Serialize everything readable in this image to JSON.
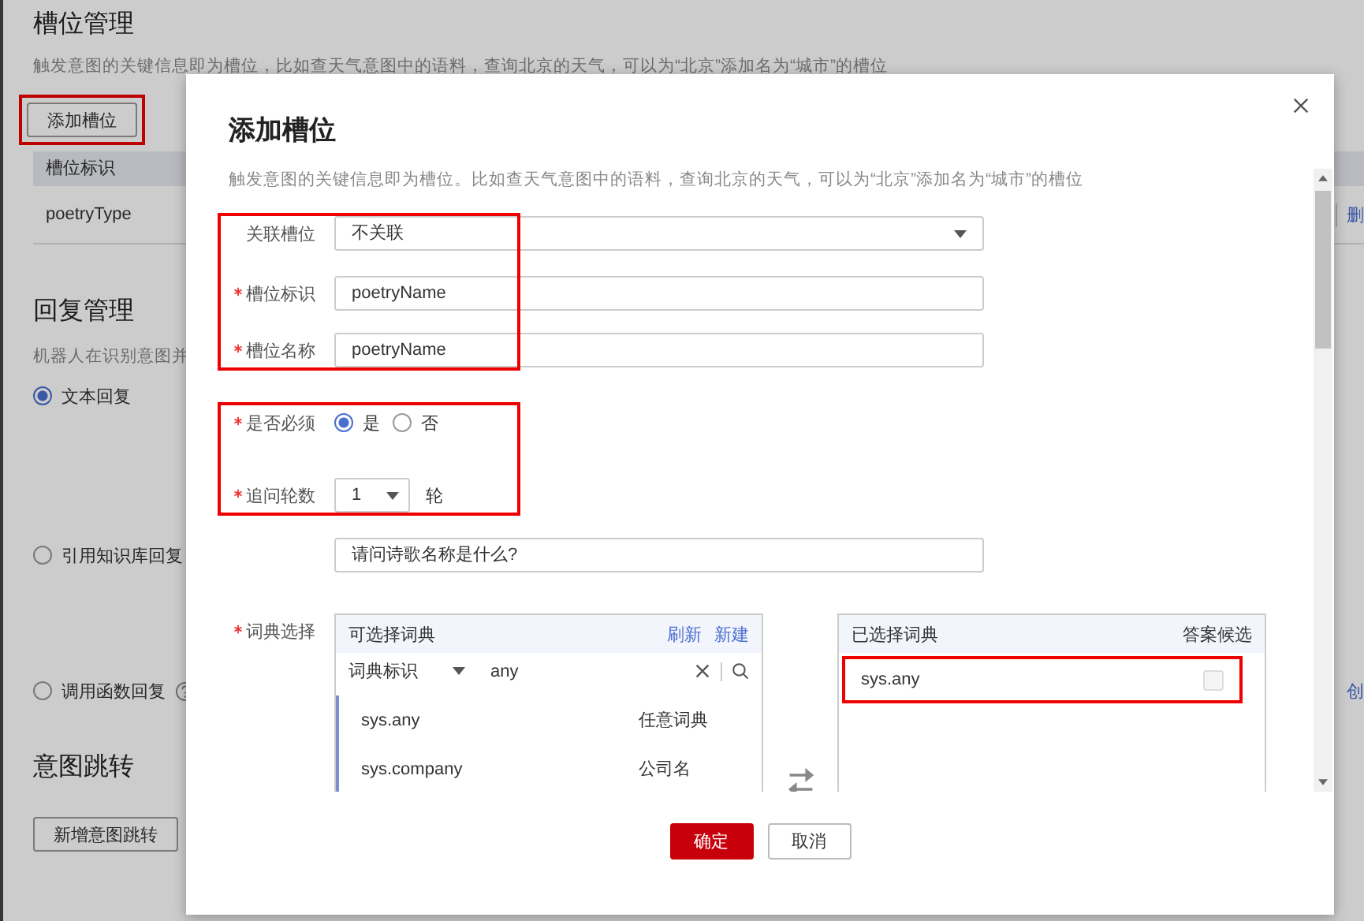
{
  "page": {
    "title": "槽位管理",
    "description": "触发意图的关键信息即为槽位，比如查天气意图中的语料，查询北京的天气，可以为“北京”添加名为“城市”的槽位",
    "add_button": {
      "label": "添加槽位",
      "highlighted": true
    },
    "table": {
      "columns": [
        "槽位标识"
      ],
      "rows": [
        {
          "cells": [
            "poetryType"
          ],
          "action": "删"
        }
      ]
    },
    "reply": {
      "title": "回复管理",
      "description": "机器人在识别意图并",
      "options": [
        {
          "label": "文本回复",
          "selected": true,
          "help": false
        },
        {
          "label": "引用知识库回复",
          "selected": false,
          "help": false
        },
        {
          "label": "调用函数回复",
          "selected": false,
          "help": true,
          "action": "创"
        }
      ]
    },
    "jump": {
      "title": "意图跳转",
      "button": "新增意图跳转"
    }
  },
  "dialog": {
    "title": "添加槽位",
    "description": "触发意图的关键信息即为槽位。比如查天气意图中的语料，查询北京的天气，可以为“北京”添加名为“城市”的槽位",
    "groups": [
      {
        "highlighted": true,
        "fields": [
          {
            "kind": "select",
            "label": "关联槽位",
            "required": false,
            "value": "不关联"
          },
          {
            "kind": "input",
            "label": "槽位标识",
            "required": true,
            "value": "poetryName"
          },
          {
            "kind": "input",
            "label": "槽位名称",
            "required": true,
            "value": "poetryName"
          }
        ]
      },
      {
        "highlighted": true,
        "fields": [
          {
            "kind": "radio",
            "label": "是否必须",
            "required": true,
            "options": [
              {
                "label": "是",
                "selected": true
              },
              {
                "label": "否",
                "selected": false
              }
            ]
          },
          {
            "kind": "count",
            "label": "追问轮数",
            "required": true,
            "value": "1",
            "unit": "轮"
          }
        ]
      },
      {
        "highlighted": false,
        "fields": [
          {
            "kind": "input",
            "required": false,
            "value": "请问诗歌名称是什么?"
          }
        ]
      }
    ],
    "dictionary": {
      "label": "词典选择",
      "required": true,
      "available": {
        "title": "可选择词典",
        "links": [
          "刷新",
          "新建"
        ],
        "filter": "词典标识",
        "query": "any",
        "items": [
          {
            "id": "sys.any",
            "name": "任意词典"
          },
          {
            "id": "sys.company",
            "name": "公司名"
          }
        ]
      },
      "chosen": {
        "title": "已选择词典",
        "column": "答案候选",
        "items": [
          {
            "id": "sys.any",
            "checked": false,
            "highlighted": true
          }
        ]
      }
    },
    "buttons": [
      {
        "label": "确定",
        "kind": "primary"
      },
      {
        "label": "取消",
        "kind": "default"
      }
    ]
  }
}
